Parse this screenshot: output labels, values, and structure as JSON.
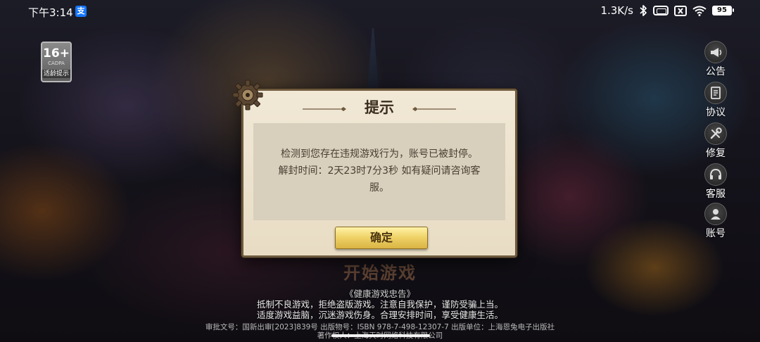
{
  "status_bar": {
    "time": "下午3:14",
    "app_icon_glyph": "支",
    "net_speed": "1.3K/s",
    "battery": "95",
    "icons": [
      "alipay-icon",
      "bluetooth-icon",
      "vibrate-icon",
      "no-sim-icon",
      "wifi-icon",
      "battery-icon"
    ]
  },
  "age_badge": {
    "rating": "16+",
    "sub": "CADPA",
    "label": "适龄提示"
  },
  "side_menu": [
    {
      "label": "公告",
      "icon": "megaphone-icon"
    },
    {
      "label": "协议",
      "icon": "document-icon"
    },
    {
      "label": "修复",
      "icon": "wrench-icon"
    },
    {
      "label": "客服",
      "icon": "headset-icon"
    },
    {
      "label": "账号",
      "icon": "user-icon"
    }
  ],
  "dialog": {
    "title": "提示",
    "message_line1": "检测到您存在违规游戏行为，账号已被封停。",
    "message_line2": "解封时间：2天23时7分3秒 如有疑问请咨询客服。",
    "confirm_label": "确定"
  },
  "start_game_label": "开始游戏",
  "health_notice": {
    "title": "《健康游戏忠告》",
    "line1": "抵制不良游戏，拒绝盗版游戏。注意自我保护，谨防受骗上当。",
    "line2": "适度游戏益脑，沉迷游戏伤身。合理安排时间，享受健康生活。"
  },
  "registration": {
    "line1": "审批文号：国新出审[2023]839号  出版物号：ISBN 978-7-498-12307-7  出版单位：上海恩兔电子出版社",
    "line2": "著作权人：上海天时网络科技有限公司"
  },
  "colors": {
    "dialog_bg": "#f1e8d6",
    "dialog_border": "#6e5a3e",
    "button_gold": "#f0d46a"
  }
}
